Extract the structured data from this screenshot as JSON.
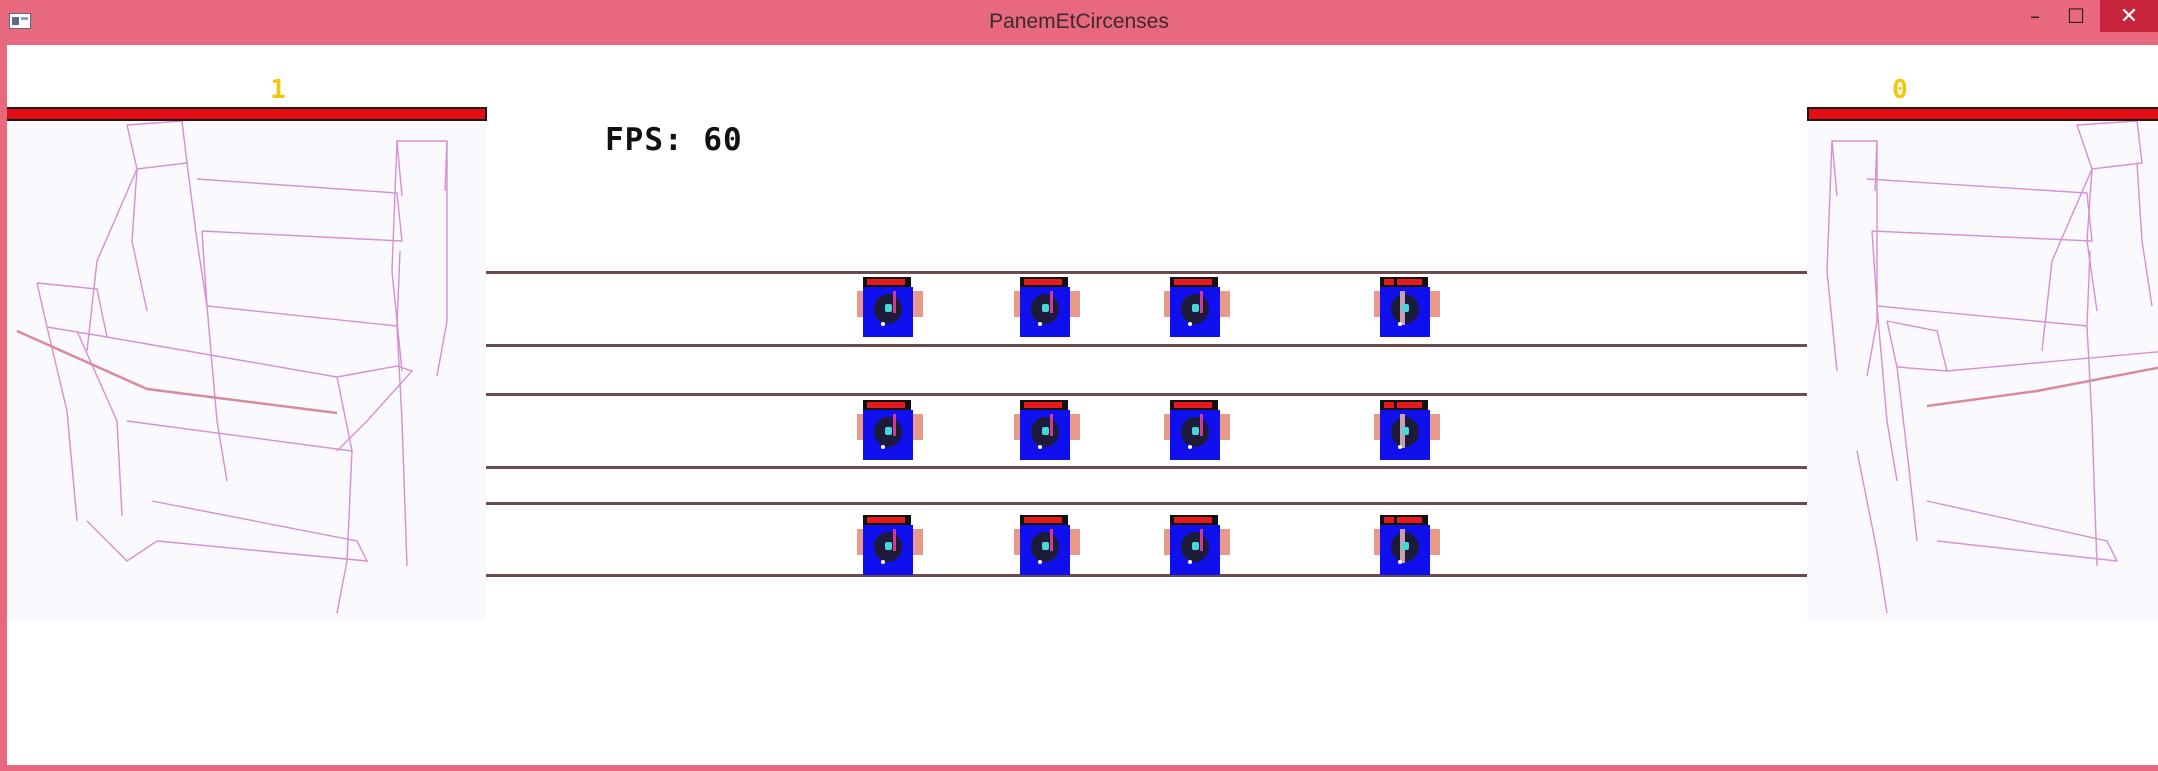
{
  "window": {
    "title": "PanemEtCircenses",
    "minimize_glyph": "–",
    "maximize_glyph": "☐",
    "close_glyph": "✕",
    "accent_color": "#e8687d",
    "close_color": "#c7233c"
  },
  "hud": {
    "player_left_score": "1",
    "player_right_score": "0",
    "fps_text": "FPS: 60",
    "health_color": "#e30d13",
    "score_color": "#f2c70b"
  },
  "arena": {
    "lanes": 3,
    "units_per_lane": 4,
    "unit_icon": "robot-unit-icon",
    "chair_icon": "wireframe-chair-icon"
  }
}
